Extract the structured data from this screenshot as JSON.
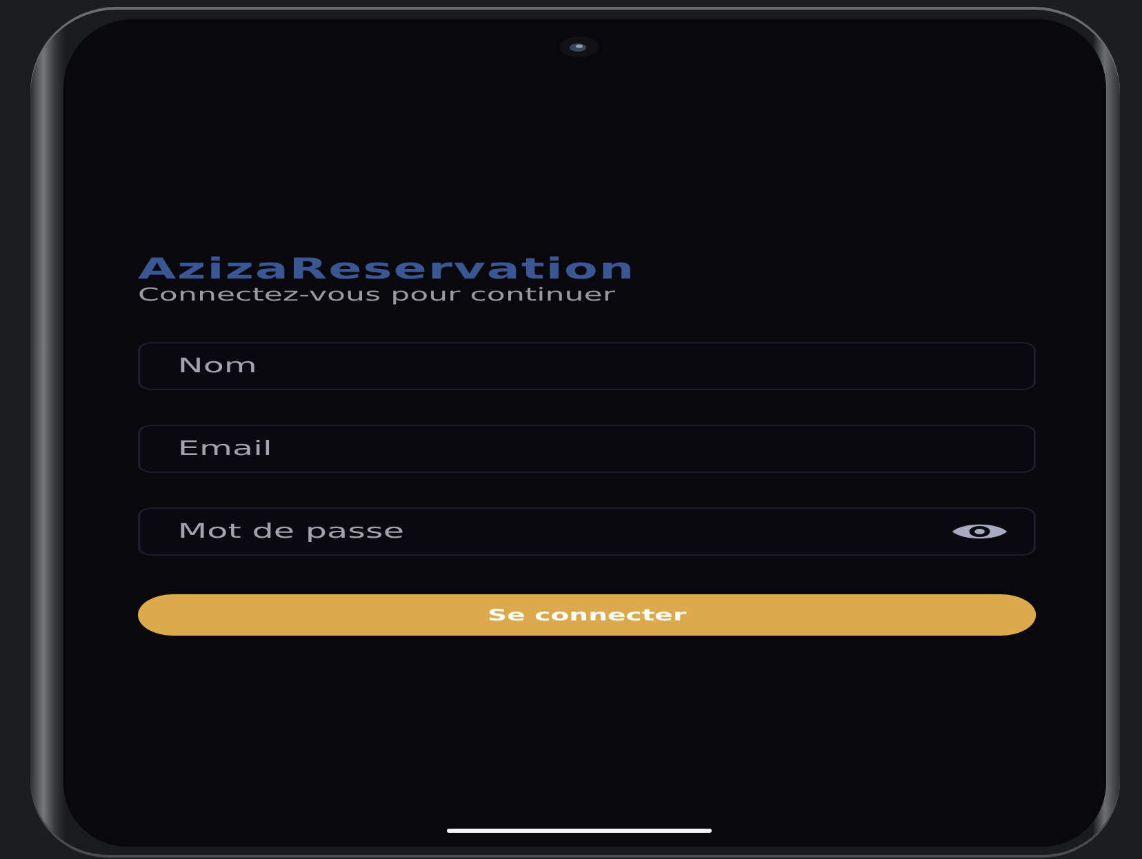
{
  "screen": {
    "title": "AzizaReservation",
    "subtitle": "Connectez-vous pour continuer"
  },
  "fields": [
    {
      "kind": "text",
      "placeholder": "Nom"
    },
    {
      "kind": "text",
      "placeholder": "Email"
    },
    {
      "kind": "password",
      "placeholder": "Mot de passe"
    }
  ],
  "button": {
    "label": "Se connecter"
  }
}
